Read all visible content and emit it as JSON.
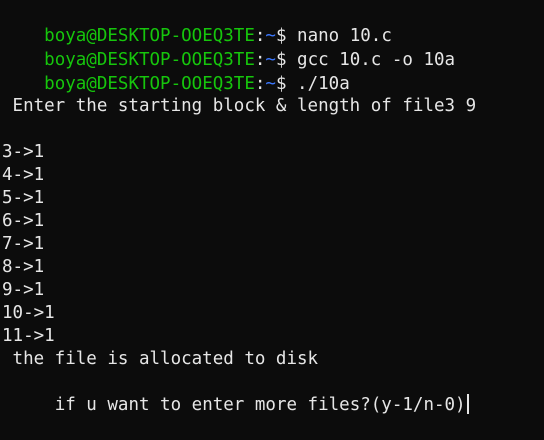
{
  "prompt": {
    "user_host": "boya@DESKTOP-OOEQ3TE",
    "colon": ":",
    "path": "~",
    "dollar": "$"
  },
  "commands": [
    " nano 10.c",
    " gcc 10.c -o 10a",
    " ./10a"
  ],
  "output": {
    "question": " Enter the starting block & length of file3 9",
    "allocations": [
      "3->1",
      "4->1",
      "5->1",
      "6->1",
      "7->1",
      "8->1",
      "9->1",
      "10->1",
      "11->1"
    ],
    "status": " the file is allocated to disk",
    "continue_prompt": " if u want to enter more files?(y-1/n-0)"
  },
  "colors": {
    "background": "#0c0c0c",
    "user_host": "#16c60c",
    "path": "#3b78ff",
    "text": "#e6e6e6"
  }
}
